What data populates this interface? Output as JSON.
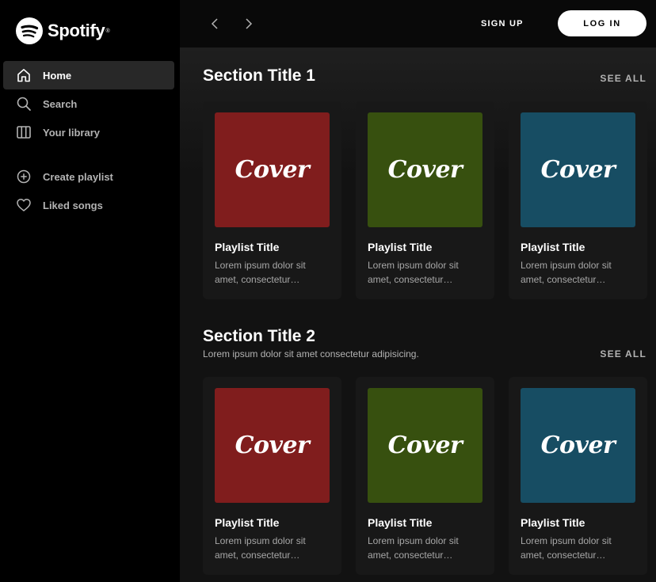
{
  "brand": {
    "name": "Spotify",
    "reg": "®",
    "icon": "spotify-logo"
  },
  "sidebar": {
    "items": [
      {
        "label": "Home",
        "icon": "home-icon",
        "active": true
      },
      {
        "label": "Search",
        "icon": "search-icon"
      },
      {
        "label": "Your library",
        "icon": "library-icon"
      }
    ],
    "actions": [
      {
        "label": "Create playlist",
        "icon": "plus-circle-icon"
      },
      {
        "label": "Liked songs",
        "icon": "heart-icon"
      }
    ]
  },
  "topbar": {
    "back_icon": "chevron-left-icon",
    "forward_icon": "chevron-right-icon",
    "signup_label": "SIGN UP",
    "login_label": "LOG IN"
  },
  "sections": [
    {
      "title": "Section Title 1",
      "subtitle": "",
      "see_all": "SEE ALL",
      "cards": [
        {
          "cover": "Cover",
          "title": "Playlist Title",
          "desc": "Lorem ipsum dolor sit amet, consectetur adipisicing elit.",
          "color": "#801d1d"
        },
        {
          "cover": "Cover",
          "title": "Playlist Title",
          "desc": "Lorem ipsum dolor sit amet, consectetur adipisicing elit.",
          "color": "#37500f"
        },
        {
          "cover": "Cover",
          "title": "Playlist Title",
          "desc": "Lorem ipsum dolor sit amet, consectetur adipisicing elit.",
          "color": "#174d63"
        }
      ]
    },
    {
      "title": "Section Title 2",
      "subtitle": "Lorem ipsum dolor sit amet consectetur adipisicing.",
      "see_all": "SEE ALL",
      "cards": [
        {
          "cover": "Cover",
          "title": "Playlist Title",
          "desc": "Lorem ipsum dolor sit amet, consectetur adipisicing elit.",
          "color": "#801d1d"
        },
        {
          "cover": "Cover",
          "title": "Playlist Title",
          "desc": "Lorem ipsum dolor sit amet, consectetur adipisicing elit.",
          "color": "#37500f"
        },
        {
          "cover": "Cover",
          "title": "Playlist Title",
          "desc": "Lorem ipsum dolor sit amet, consectetur adipisicing elit.",
          "color": "#174d63"
        }
      ]
    }
  ]
}
